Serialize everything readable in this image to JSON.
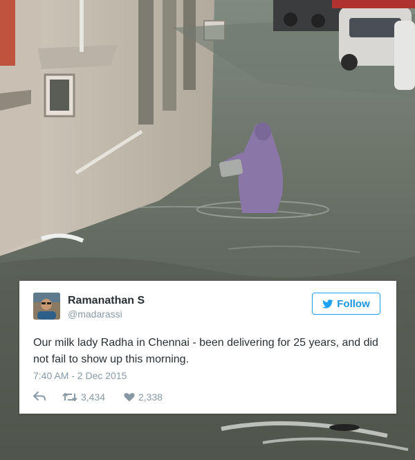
{
  "tweet": {
    "display_name": "Ramanathan S",
    "handle": "@madarassi",
    "follow_label": "Follow",
    "text": "Our milk lady Radha in Chennai - been delivering for 25 years, and did not fail to show up this morning.",
    "timestamp": "7:40 AM - 2 Dec 2015",
    "actions": {
      "reply_icon": "reply-icon",
      "retweet_icon": "retweet-icon",
      "retweet_count": "3,434",
      "like_icon": "heart-icon",
      "like_count": "2,338"
    },
    "follow_icon": "twitter-bird-icon"
  },
  "colors": {
    "accent": "#1da1f2",
    "name_text": "#292f33",
    "muted_text": "#8899a6",
    "card_background": "#ffffff",
    "floodwater": "#5d6256",
    "raincoat": "#8a77a8"
  }
}
